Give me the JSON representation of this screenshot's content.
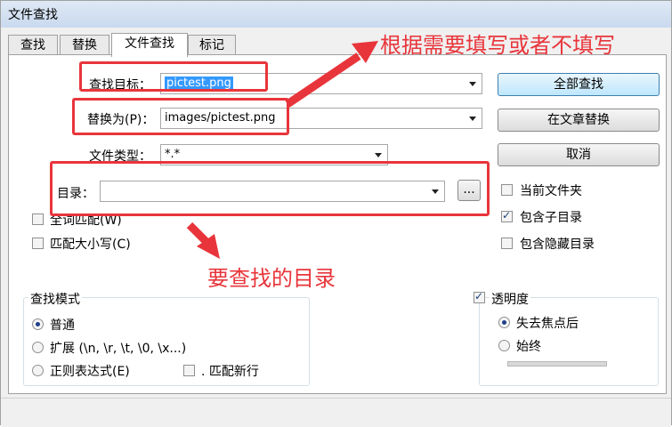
{
  "window": {
    "title": "文件查找"
  },
  "tabs": [
    {
      "label": "查找",
      "active": false
    },
    {
      "label": "替换",
      "active": false
    },
    {
      "label": "文件查找",
      "active": true
    },
    {
      "label": "标记",
      "active": false
    }
  ],
  "form": {
    "find_label": "查找目标：",
    "find_value": "pictest.png",
    "replace_label": "替换为(P)：",
    "replace_value": "images/pictest.png",
    "filetype_label": "文件类型：",
    "filetype_value": "*.*",
    "dir_label": "目录：",
    "dir_value": "",
    "browse_label": "..."
  },
  "buttons": {
    "find_all": "全部查找",
    "replace_in_files": "在文章替换",
    "cancel": "取消"
  },
  "options": {
    "whole_word": {
      "label": "全词匹配(W)",
      "checked": false
    },
    "match_case": {
      "label": "匹配大小写(C)",
      "checked": false
    },
    "current_folder": {
      "label": "当前文件夹",
      "checked": false
    },
    "include_subdirs": {
      "label": "包含子目录",
      "checked": true
    },
    "include_hidden": {
      "label": "包含隐藏目录",
      "checked": false
    }
  },
  "search_mode": {
    "title": "查找模式",
    "normal": {
      "label": "普通",
      "selected": true
    },
    "extended": {
      "label": "扩展 (\\n, \\r, \\t, \\0, \\x...)",
      "selected": false
    },
    "regex": {
      "label": "正则表达式(E)",
      "selected": false
    },
    "match_newline": {
      "label": ". 匹配新行",
      "checked": false
    }
  },
  "transparency": {
    "title": "透明度",
    "checked": true,
    "on_lose_focus": {
      "label": "失去焦点后",
      "selected": true
    },
    "always": {
      "label": "始终",
      "selected": false
    }
  },
  "annotations": {
    "top_note": "根据需要填写或者不填写",
    "dir_note": "要查找的目录"
  },
  "colors": {
    "annotation_red": "#e8353b",
    "selection_blue": "#3399ff"
  }
}
